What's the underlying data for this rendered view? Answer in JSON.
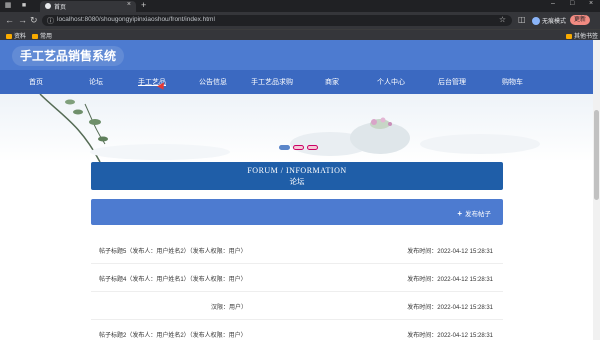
{
  "browser": {
    "tab_title": "首页",
    "url": "localhost:8080/shougongyipinxiaoshou/front/index.html",
    "profile_label": "无痕模式",
    "update_label": "更新",
    "bookmarks": [
      "资料",
      "常用"
    ],
    "other_bookmarks": "其他书签"
  },
  "site": {
    "title": "手工艺品销售系统",
    "nav": [
      "首页",
      "论坛",
      "手工艺品",
      "公告信息",
      "手工艺品求购",
      "商家",
      "个人中心",
      "后台管理",
      "购物车"
    ],
    "active_nav_index": 2
  },
  "forum": {
    "heading_en": "FORUM / INFORMATION",
    "heading_zh": "论坛",
    "post_button": "发布帖子",
    "posts": [
      {
        "title": "帖子标题5（发布人：用户姓名2）（发布人权限：用户）",
        "date": "发布时间：2022-04-12 15:28:31"
      },
      {
        "title": "帖子标题4（发布人：用户姓名1）（发布人权限：用户）",
        "date": "发布时间：2022-04-12 15:28:31"
      },
      {
        "title": "汉限：用户）",
        "date": "发布时间：2022-04-12 15:28:31"
      },
      {
        "title": "帖子标题2（发布人：用户姓名2）（发布人权限：用户）",
        "date": "发布时间：2022-04-12 15:28:31"
      }
    ]
  },
  "colors": {
    "header_blue": "#4d7bd0",
    "nav_blue": "#3b69c1",
    "forum_head": "#1f5ea8"
  }
}
